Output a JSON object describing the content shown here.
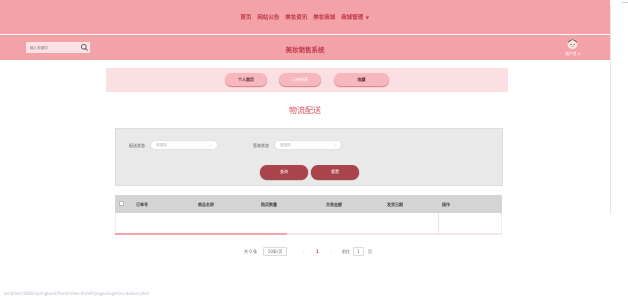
{
  "nav": {
    "items": [
      "首页",
      "网站公告",
      "美妆资讯",
      "美妆商城",
      "商城管理 ∨"
    ]
  },
  "header": {
    "search_placeholder": "输入关键词",
    "site_title": "美妆销售系统",
    "username": "账户名 ∨"
  },
  "tabs": [
    "个人首页",
    "订单列表",
    "收藏"
  ],
  "page_heading": "物流配送",
  "filter": {
    "delivery_label": "配送状态",
    "delivery_placeholder": "请选择",
    "sign_label": "签收状态",
    "sign_placeholder": "请选择",
    "search_button": "查询",
    "reset_button": "重置"
  },
  "table": {
    "columns": [
      "订单号",
      "商品名称",
      "购买数量",
      "交易金额",
      "发货日期",
      "操作"
    ]
  },
  "pagination": {
    "total": "共 0 条",
    "page_size": "10条/页",
    "prev": "‹",
    "current": "1",
    "next": "›",
    "goto_label": "前往",
    "goto_value": "1",
    "goto_unit": "页"
  },
  "status_url": "localhost:8080/springboot/front/index.html#/pages/logistics-delivery/list",
  "colors": {
    "header_pink": "#f3a2a8",
    "accent_red": "#c2394a",
    "button_dark": "#a9434c"
  }
}
